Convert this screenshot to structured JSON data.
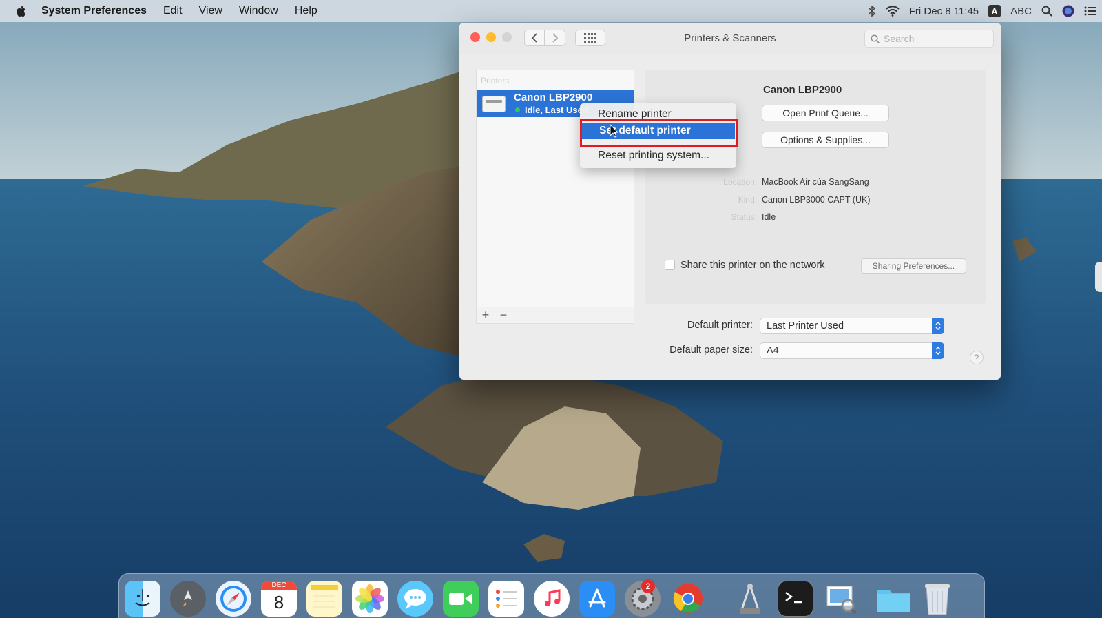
{
  "menubar": {
    "app_name": "System Preferences",
    "menus": [
      "Edit",
      "View",
      "Window",
      "Help"
    ],
    "datetime": "Fri Dec 8  11:45",
    "input_source": "ABC"
  },
  "window": {
    "title": "Printers & Scanners",
    "search_placeholder": "Search"
  },
  "printers": {
    "header": "Printers",
    "items": [
      {
        "name": "Canon LBP2900",
        "status": "Idle, Last Used"
      }
    ]
  },
  "context_menu": {
    "items": [
      "Rename printer",
      "Set default printer",
      "Reset printing system..."
    ],
    "highlighted": "Set default printer"
  },
  "detail": {
    "title": "Canon LBP2900",
    "open_queue": "Open Print Queue...",
    "options": "Options & Supplies...",
    "location_label": "Location:",
    "location_value": "MacBook Air của SangSang",
    "kind_label": "Kind:",
    "kind_value": "Canon LBP3000 CAPT (UK)",
    "status_label": "Status:",
    "status_value": "Idle",
    "share_label": "Share this printer on the network",
    "share_checked": false,
    "sharing_prefs": "Sharing Preferences..."
  },
  "defaults": {
    "printer_label": "Default printer:",
    "printer_value": "Last Printer Used",
    "paper_label": "Default paper size:",
    "paper_value": "A4"
  },
  "dock": {
    "items": [
      "Finder",
      "Launchpad",
      "Safari",
      "Calendar",
      "Notes",
      "Photos",
      "Messages",
      "FaceTime",
      "Reminders",
      "Music",
      "App Store",
      "System Preferences",
      "Google Chrome",
      "Printer Setup",
      "Terminal",
      "Preview",
      "Folder",
      "Trash"
    ],
    "calendar_month": "DEC",
    "calendar_day": "8",
    "system_prefs_badge": "2"
  },
  "colors": {
    "accent": "#2b73d6",
    "highlight_box": "#e21b22"
  }
}
